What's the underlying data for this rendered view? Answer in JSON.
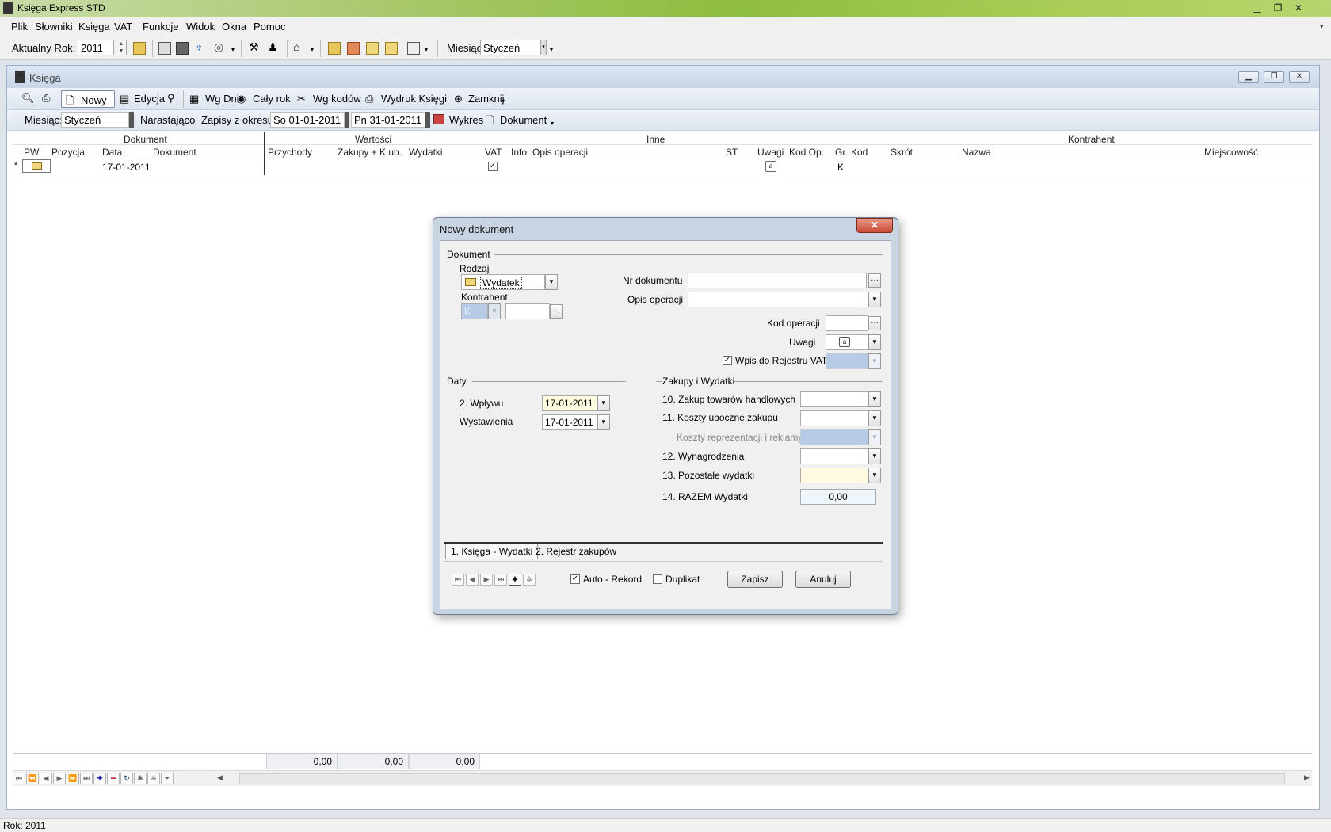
{
  "app": {
    "title": "Księga Express STD"
  },
  "menu": [
    "Plik",
    "Słowniki",
    "Księga",
    "VAT",
    "Funkcje",
    "Widok",
    "Okna",
    "Pomoc"
  ],
  "toolbar": {
    "year_label": "Aktualny Rok:",
    "year_value": "2011",
    "month_label": "Miesiąc",
    "month_value": "Styczeń"
  },
  "child": {
    "title": "Księga",
    "tb1": {
      "new": "Nowy",
      "edit": "Edycja",
      "by_days": "Wg Dni",
      "whole_year": "Cały rok",
      "by_codes": "Wg kodów",
      "print": "Wydruk Księgi",
      "close": "Zamknij"
    },
    "tb2": {
      "month_label": "Miesiąc:",
      "month_value": "Styczeń",
      "cumulative": "Narastająco",
      "period_label": "Zapisy z okresu:",
      "date_from": "So 01-01-2011",
      "date_to": "Pn 31-01-2011",
      "chart": "Wykres",
      "document": "Dokument"
    }
  },
  "grid": {
    "groups": [
      "Dokument",
      "Wartości",
      "Inne",
      "Kontrahent"
    ],
    "columns": [
      "PW",
      "Pozycja",
      "Data",
      "Dokument",
      "Przychody",
      "Zakupy + K.ub.",
      "Wydatki",
      "VAT",
      "Info",
      "Opis operacji",
      "ST",
      "Uwagi",
      "Kod Op.",
      "Gr",
      "Kod",
      "Skrót",
      "Nazwa",
      "Miejscowość"
    ],
    "row": {
      "marker": "*",
      "date": "17-01-2011",
      "vat_checked": true,
      "gr": "K"
    },
    "totals": [
      "0,00",
      "0,00",
      "0,00"
    ]
  },
  "status": "Rok: 2011",
  "dialog": {
    "title": "Nowy dokument",
    "group_document": "Dokument",
    "type_label": "Rodzaj",
    "type_value": "Wydatek",
    "contractor_label": "Kontrahent",
    "contractor_value": "K",
    "doc_no_label": "Nr dokumentu",
    "op_desc_label": "Opis operacji",
    "op_code_label": "Kod operacji",
    "notes_label": "Uwagi",
    "vat_register_label": "Wpis do Rejestru VAT",
    "group_dates": "Daty",
    "date_inflow_label": "2. Wpływu",
    "date_inflow_value": "17-01-2011",
    "date_issue_label": "Wystawienia",
    "date_issue_value": "17-01-2011",
    "group_purchases": "Zakupy i Wydatki",
    "f10": "10. Zakup towarów handlowych",
    "f11": "11. Koszty uboczne zakupu",
    "frep": "Koszty reprezentacji i reklamy",
    "f12": "12. Wynagrodzenia",
    "f13": "13. Pozostałe wydatki",
    "f14": "14. RAZEM Wydatki",
    "total_value": "0,00",
    "tab1": "1. Księga - Wydatki",
    "tab2": "2. Rejestr zakupów",
    "auto_record": "Auto - Rekord",
    "duplicate": "Duplikat",
    "save": "Zapisz",
    "cancel": "Anuluj"
  }
}
